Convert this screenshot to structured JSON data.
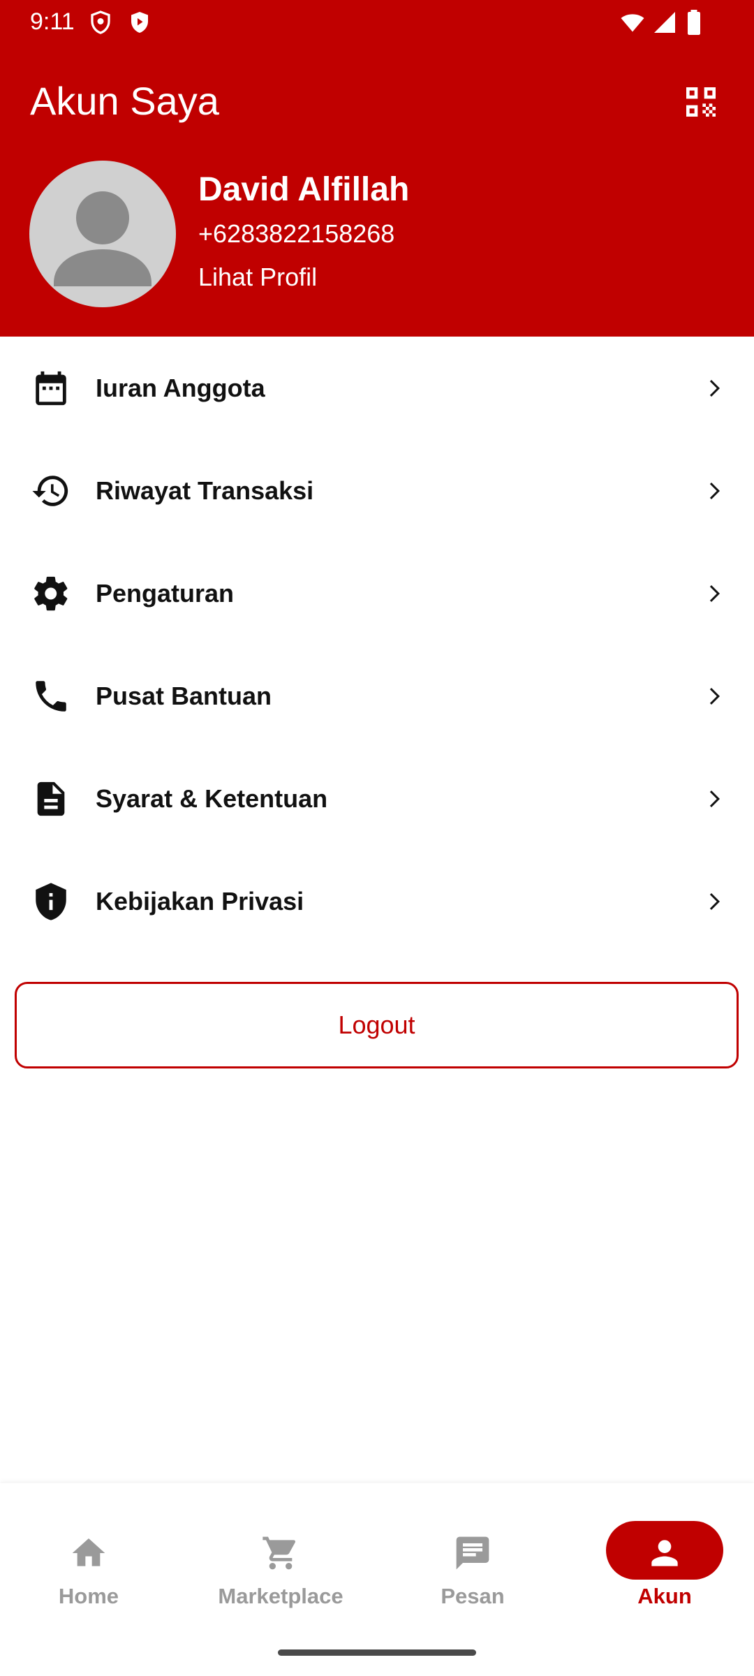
{
  "status_bar": {
    "time": "9:11"
  },
  "header": {
    "title": "Akun Saya",
    "qr_icon": "qr-code-icon"
  },
  "profile": {
    "name": "David Alfillah",
    "phone": "+6283822158268",
    "view_profile": "Lihat Profil"
  },
  "menu": {
    "items": [
      {
        "label": "Iuran Anggota",
        "icon": "calendar-icon"
      },
      {
        "label": "Riwayat Transaksi",
        "icon": "history-icon"
      },
      {
        "label": "Pengaturan",
        "icon": "gear-icon"
      },
      {
        "label": "Pusat Bantuan",
        "icon": "phone-icon"
      },
      {
        "label": "Syarat & Ketentuan",
        "icon": "document-icon"
      },
      {
        "label": "Kebijakan Privasi",
        "icon": "shield-info-icon"
      }
    ]
  },
  "logout_label": "Logout",
  "bottom_nav": {
    "items": [
      {
        "label": "Home",
        "icon": "home-icon",
        "active": false
      },
      {
        "label": "Marketplace",
        "icon": "cart-icon",
        "active": false
      },
      {
        "label": "Pesan",
        "icon": "message-icon",
        "active": false
      },
      {
        "label": "Akun",
        "icon": "person-icon",
        "active": true
      }
    ]
  },
  "colors": {
    "primary": "#c00000",
    "inactive": "#9a9a9a",
    "text": "#111111"
  }
}
